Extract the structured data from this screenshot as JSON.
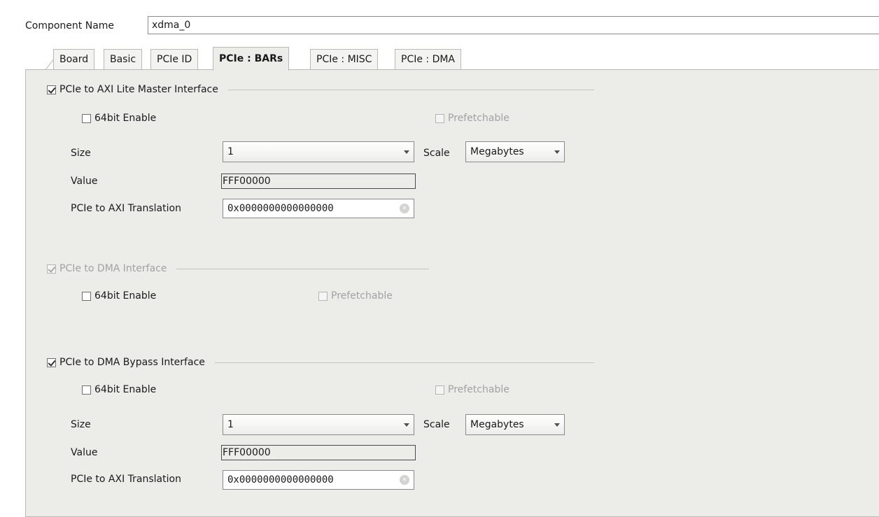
{
  "component": {
    "label": "Component Name",
    "value": "xdma_0"
  },
  "tabs": [
    {
      "label": "Board"
    },
    {
      "label": "Basic"
    },
    {
      "label": "PCIe ID"
    },
    {
      "label": "PCIe : BARs",
      "active": true
    },
    {
      "label": "PCIe : MISC"
    },
    {
      "label": "PCIe : DMA"
    }
  ],
  "sections": [
    {
      "title": "PCIe to AXI Lite Master Interface",
      "checked": true,
      "enable64": {
        "label": "64bit Enable",
        "checked": false
      },
      "prefetch": {
        "label": "Prefetchable",
        "checked": false
      },
      "size": {
        "label": "Size",
        "value": "1"
      },
      "scale": {
        "label": "Scale",
        "value": "Megabytes"
      },
      "value": {
        "label": "Value",
        "value": "FFF00000"
      },
      "translation": {
        "label": "PCIe to AXI Translation",
        "value": "0x0000000000000000"
      }
    },
    {
      "title": "PCIe to DMA Interface",
      "checked": true,
      "enable64": {
        "label": "64bit Enable",
        "checked": false
      },
      "prefetch": {
        "label": "Prefetchable",
        "checked": false
      }
    },
    {
      "title": "PCIe to DMA Bypass Interface",
      "checked": true,
      "enable64": {
        "label": "64bit Enable",
        "checked": false
      },
      "prefetch": {
        "label": "Prefetchable",
        "checked": false
      },
      "size": {
        "label": "Size",
        "value": "1"
      },
      "scale": {
        "label": "Scale",
        "value": "Megabytes"
      },
      "value": {
        "label": "Value",
        "value": "FFF00000"
      },
      "translation": {
        "label": "PCIe to AXI Translation",
        "value": "0x0000000000000000"
      }
    }
  ],
  "icons": {
    "clear": "clear-icon",
    "dropdown": "chevron-down-icon",
    "check": "checkmark-icon"
  },
  "colors": {
    "panel": "#ecece9",
    "border": "#b9b9b6",
    "disabled_text": "#a2a2a2"
  }
}
